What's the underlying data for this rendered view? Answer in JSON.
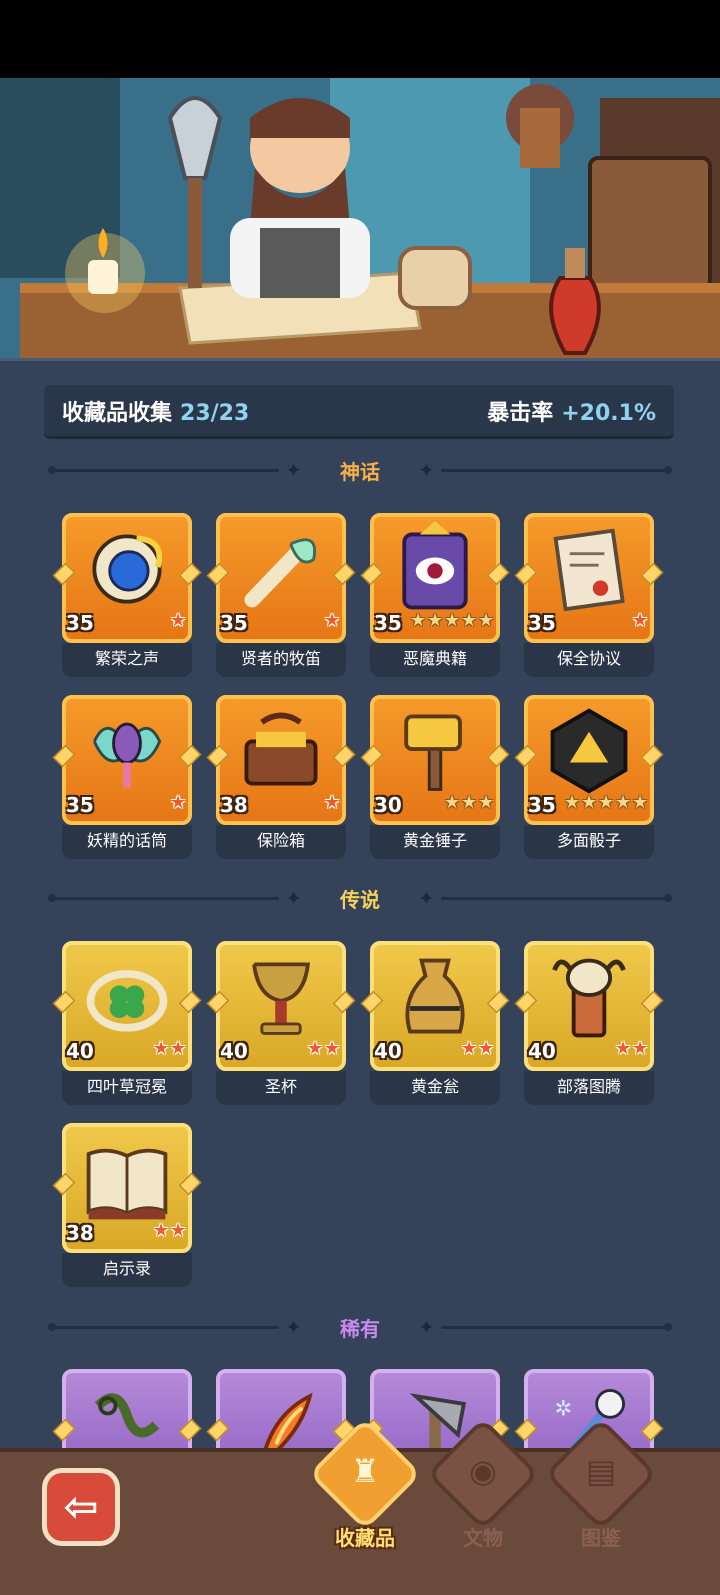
{
  "summary": {
    "label": "收藏品收集",
    "count": "23/23",
    "bonus_label": "暴击率",
    "bonus_value": "+20.1%"
  },
  "sections": {
    "mythic": {
      "title": "神话",
      "color": "#f5b04a"
    },
    "legend": {
      "title": "传说",
      "color": "#f5d25a"
    },
    "rare": {
      "title": "稀有",
      "color": "#c88af0"
    }
  },
  "mythic_items": [
    {
      "name": "繁荣之声",
      "level": "35",
      "stars": 1,
      "icon": "conch-shell-icon"
    },
    {
      "name": "贤者的牧笛",
      "level": "35",
      "stars": 1,
      "icon": "flute-icon"
    },
    {
      "name": "恶魔典籍",
      "level": "35",
      "stars": 5,
      "icon": "demon-book-icon"
    },
    {
      "name": "保全协议",
      "level": "35",
      "stars": 1,
      "icon": "contract-scroll-icon"
    },
    {
      "name": "妖精的话筒",
      "level": "35",
      "stars": 1,
      "icon": "fairy-microphone-icon"
    },
    {
      "name": "保险箱",
      "level": "38",
      "stars": 1,
      "icon": "treasure-chest-icon"
    },
    {
      "name": "黄金锤子",
      "level": "30",
      "stars": 3,
      "icon": "golden-hammer-icon"
    },
    {
      "name": "多面骰子",
      "level": "35",
      "stars": 5,
      "icon": "d20-dice-icon"
    }
  ],
  "legend_items": [
    {
      "name": "四叶草冠冕",
      "level": "40",
      "stars": 2,
      "icon": "clover-crown-icon"
    },
    {
      "name": "圣杯",
      "level": "40",
      "stars": 2,
      "icon": "grail-icon"
    },
    {
      "name": "黄金瓮",
      "level": "40",
      "stars": 2,
      "icon": "golden-urn-icon"
    },
    {
      "name": "部落图腾",
      "level": "40",
      "stars": 2,
      "icon": "tribal-totem-icon"
    },
    {
      "name": "启示录",
      "level": "38",
      "stars": 2,
      "icon": "revelation-book-icon"
    }
  ],
  "rare_items": [
    {
      "icon": "thorn-vine-icon"
    },
    {
      "icon": "flame-feather-icon"
    },
    {
      "icon": "stone-axe-icon"
    },
    {
      "icon": "skull-staff-icon"
    }
  ],
  "nav": {
    "back_icon": "back-arrow-icon",
    "tabs": [
      {
        "label": "收藏品",
        "icon": "collection-icon"
      },
      {
        "label": "文物",
        "icon": "eye-relic-icon"
      },
      {
        "label": "图鉴",
        "icon": "book-icon"
      }
    ]
  }
}
